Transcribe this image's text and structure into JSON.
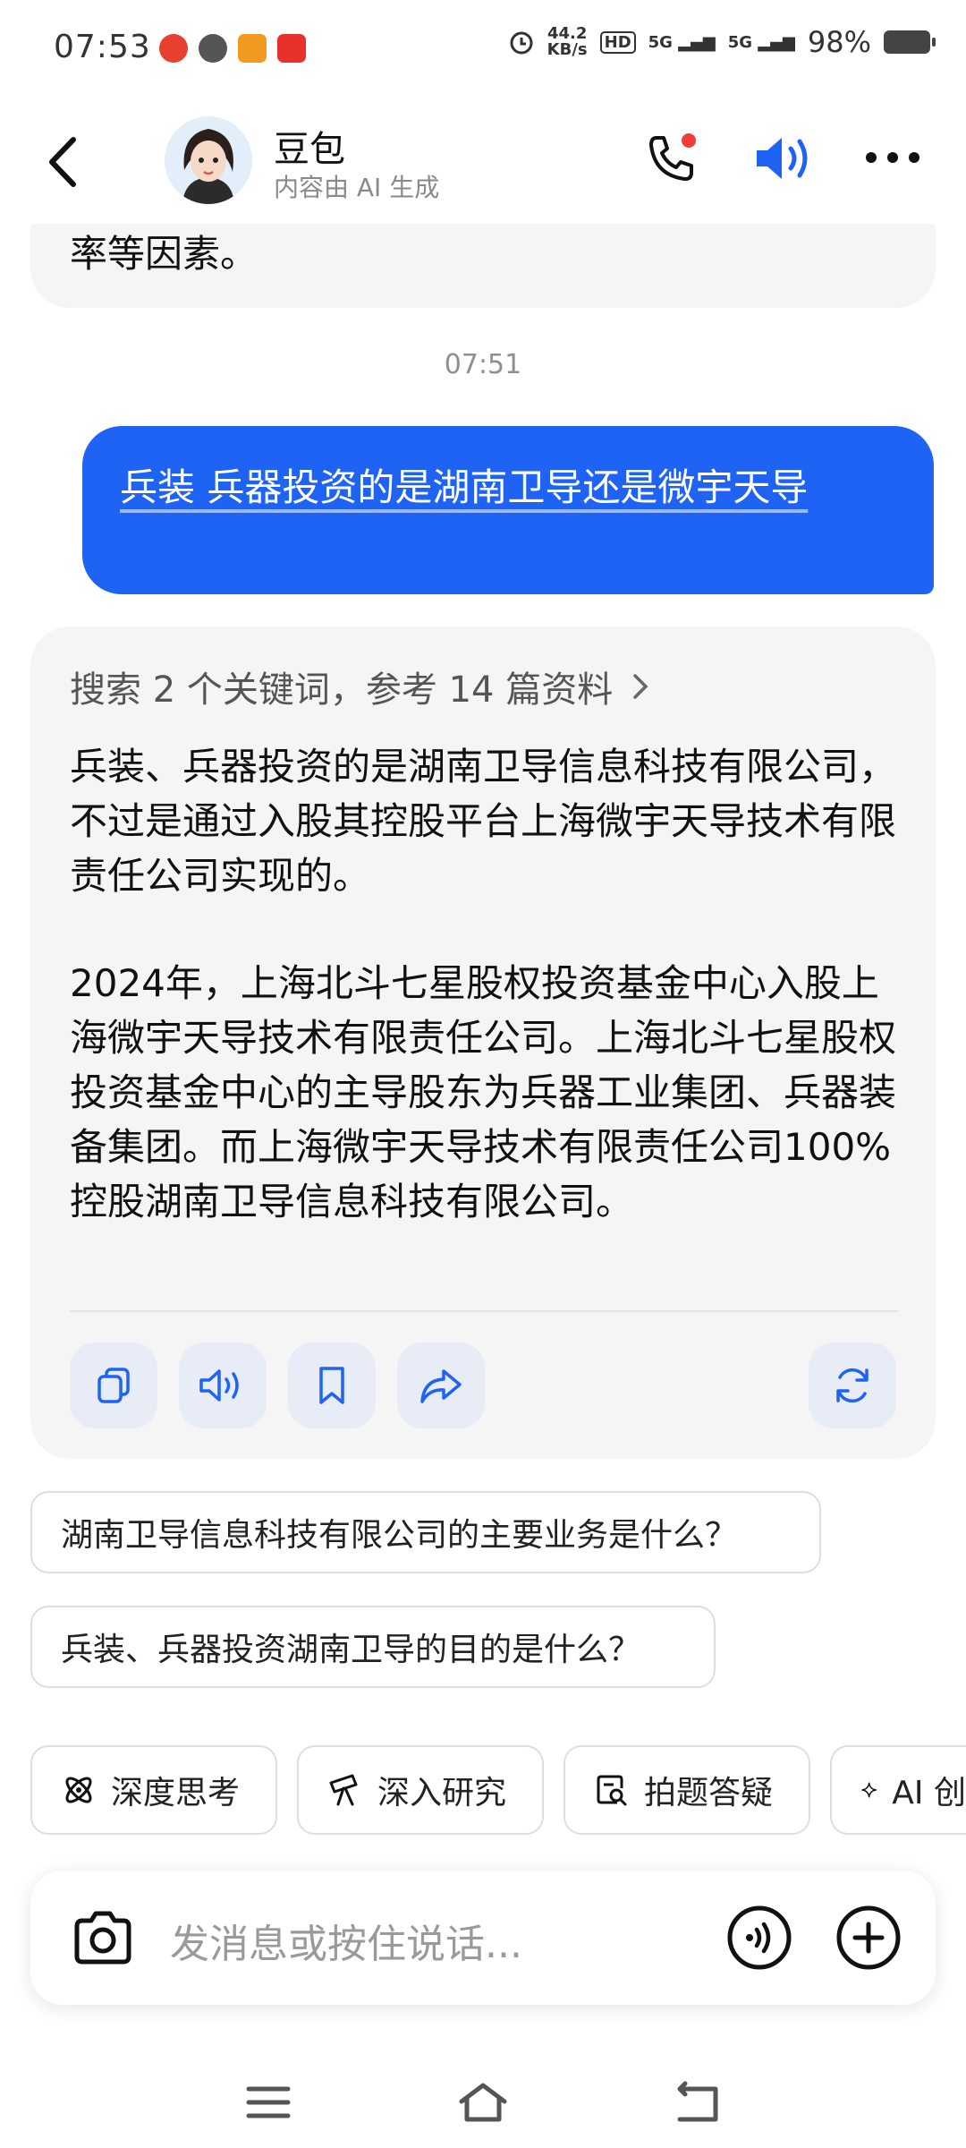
{
  "status_bar": {
    "time": "07:53",
    "speed_value": "44.2",
    "speed_unit": "KB/s",
    "hd": "HD",
    "signal1": "5G",
    "signal2": "5G",
    "battery": "98%"
  },
  "header": {
    "name": "豆包",
    "subtitle": "内容由 AI 生成"
  },
  "chat": {
    "previous_tail": "率等因素。",
    "timestamp": "07:51",
    "user_message": "兵装  兵器投资的是湖南卫导还是微宇天导",
    "search_summary": "搜索 2 个关键词，参考 14 篇资料",
    "answer_p1": "兵装、兵器投资的是湖南卫导信息科技有限公司，不过是通过入股其控股平台上海微宇天导技术有限责任公司实现的。",
    "answer_p2": "2024年，上海北斗七星股权投资基金中心入股上海微宇天导技术有限责任公司。上海北斗七星股权投资基金中心的主导股东为兵器工业集团、兵器装备集团。而上海微宇天导技术有限责任公司100%控股湖南卫导信息科技有限公司。"
  },
  "suggestions": [
    "湖南卫导信息科技有限公司的主要业务是什么？",
    "兵装、兵器投资湖南卫导的目的是什么？"
  ],
  "chips": [
    {
      "label": "深度思考",
      "icon": "atom-icon"
    },
    {
      "label": "深入研究",
      "icon": "telescope-icon"
    },
    {
      "label": "拍题答疑",
      "icon": "photo-search-icon"
    },
    {
      "label": "AI 创",
      "icon": "sparkle-icon"
    }
  ],
  "composer": {
    "placeholder": "发消息或按住说话..."
  },
  "colors": {
    "accent": "#1f63f5",
    "bubble_gray": "#f5f5f5",
    "notification_dot": "#f23c3c"
  }
}
